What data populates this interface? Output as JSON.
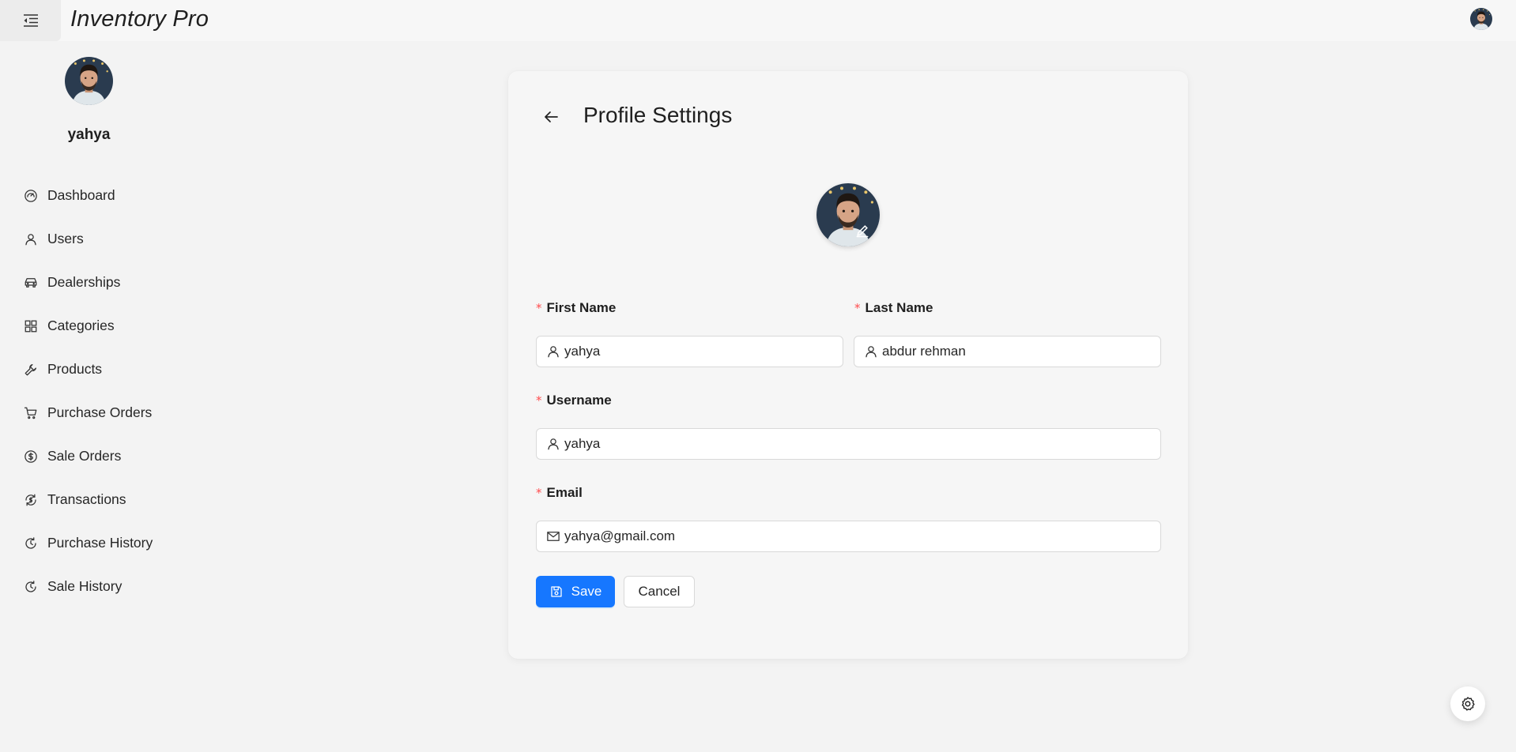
{
  "app": {
    "title": "Inventory Pro"
  },
  "sidebar": {
    "username": "yahya",
    "items": [
      {
        "label": "Dashboard",
        "icon": "dashboard-icon"
      },
      {
        "label": "Users",
        "icon": "user-icon"
      },
      {
        "label": "Dealerships",
        "icon": "car-icon"
      },
      {
        "label": "Categories",
        "icon": "grid-icon"
      },
      {
        "label": "Products",
        "icon": "wrench-icon"
      },
      {
        "label": "Purchase Orders",
        "icon": "cart-icon"
      },
      {
        "label": "Sale Orders",
        "icon": "dollar-circle-icon"
      },
      {
        "label": "Transactions",
        "icon": "transaction-icon"
      },
      {
        "label": "Purchase History",
        "icon": "history-icon"
      },
      {
        "label": "Sale History",
        "icon": "history-icon"
      }
    ]
  },
  "profile": {
    "title": "Profile Settings",
    "fields": {
      "first_name": {
        "label": "First Name",
        "value": "yahya",
        "required": true
      },
      "last_name": {
        "label": "Last Name",
        "value": "abdur rehman",
        "required": true
      },
      "username": {
        "label": "Username",
        "value": "yahya",
        "required": true
      },
      "email": {
        "label": "Email",
        "value": "yahya@gmail.com",
        "required": true
      }
    },
    "required_marker": "*",
    "save_label": "Save",
    "cancel_label": "Cancel"
  },
  "colors": {
    "primary": "#1677ff",
    "required": "#ff4d4f",
    "background": "#f3f3f3"
  }
}
